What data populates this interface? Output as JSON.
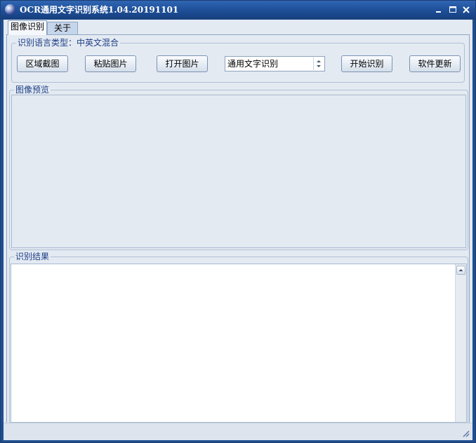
{
  "window": {
    "title": "OCR通用文字识别系统1.04.20191101",
    "controls": {
      "minimize": "minimize-icon",
      "maximize": "maximize-icon",
      "close": "close-icon"
    }
  },
  "tabs": [
    {
      "label": "图像识别",
      "active": true
    },
    {
      "label": "关于",
      "active": false
    }
  ],
  "language_group": {
    "label": "识别语言类型：中英文混合"
  },
  "toolbar": {
    "region_capture": "区域截图",
    "paste_image": "粘贴图片",
    "open_image": "打开图片",
    "recognition_mode": "通用文字识别",
    "start_recognition": "开始识别",
    "software_update": "软件更新"
  },
  "preview": {
    "label": "图像预览"
  },
  "result": {
    "label": "识别结果",
    "text": ""
  },
  "colors": {
    "titlebar": "#1d4d95",
    "client_bg": "#e4eaf2",
    "group_label": "#1c3e86",
    "button_border": "#7a93b3"
  }
}
